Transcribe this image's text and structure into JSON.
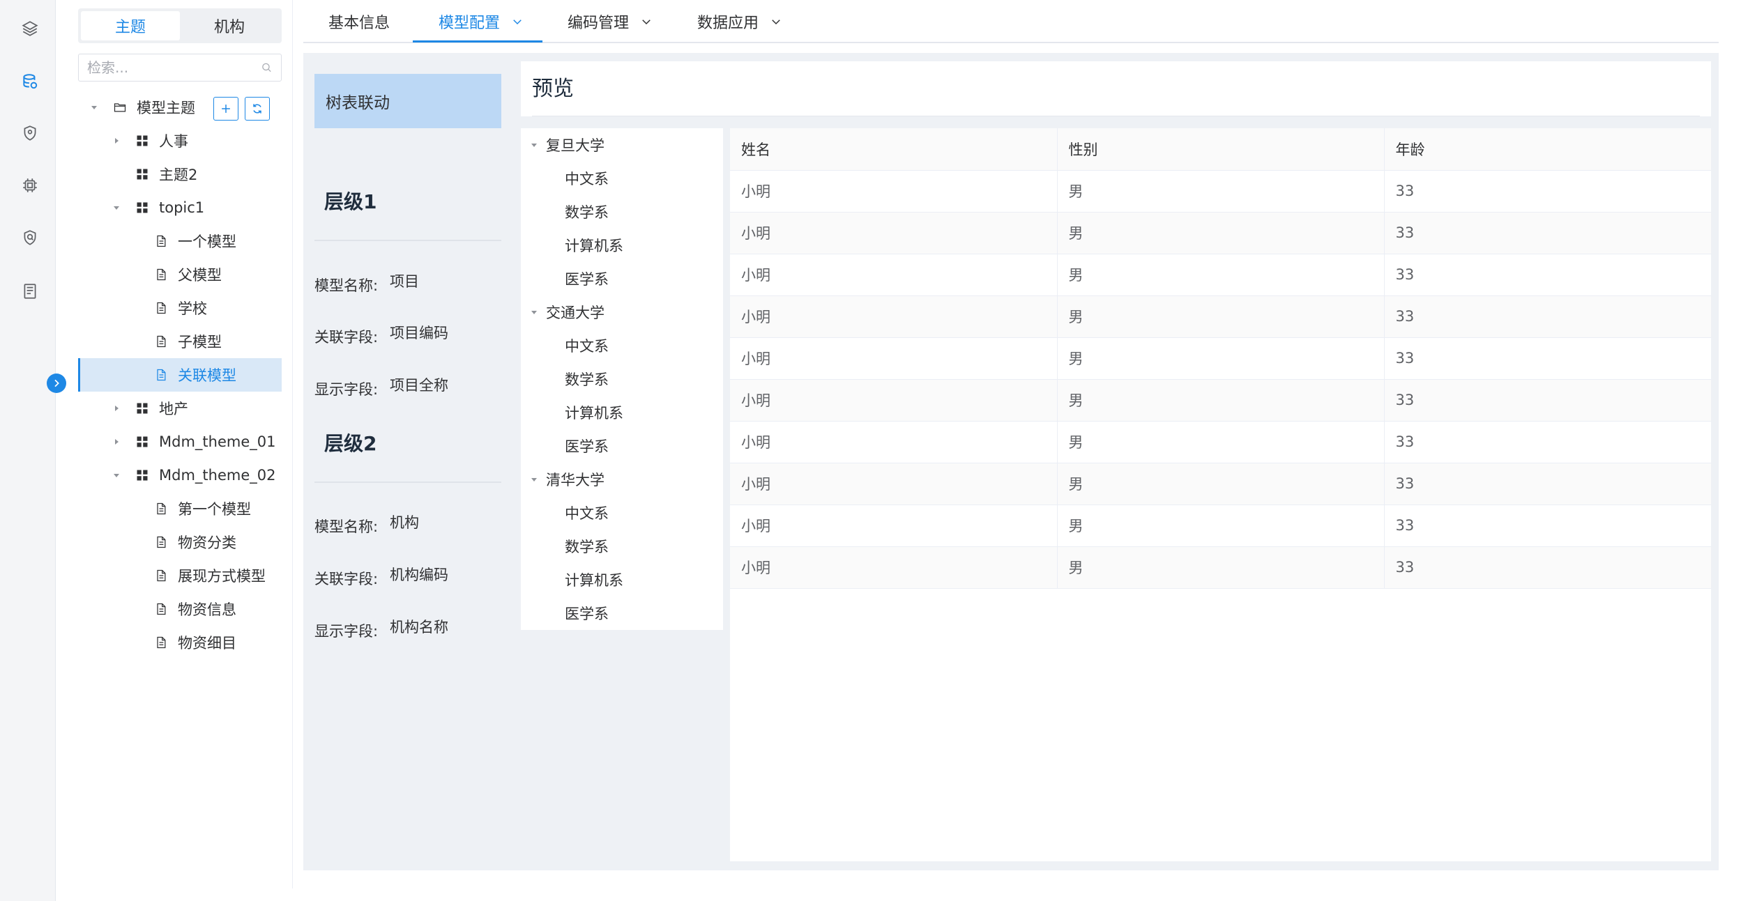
{
  "sidebar": {
    "segment": {
      "left": "主题",
      "right": "机构"
    },
    "search_placeholder": "检索...",
    "tree": [
      {
        "label": "模型主题",
        "kind": "folder",
        "caret": "down",
        "indent": 0
      },
      {
        "label": "人事",
        "kind": "grid",
        "caret": "right",
        "indent": 1
      },
      {
        "label": "主题2",
        "kind": "grid",
        "caret": "none",
        "indent": 1
      },
      {
        "label": "topic1",
        "kind": "grid",
        "caret": "down",
        "indent": 1
      },
      {
        "label": "一个模型",
        "kind": "doc",
        "caret": "none",
        "indent": 2
      },
      {
        "label": "父模型",
        "kind": "doc",
        "caret": "none",
        "indent": 2
      },
      {
        "label": "学校",
        "kind": "doc",
        "caret": "none",
        "indent": 2
      },
      {
        "label": "子模型",
        "kind": "doc",
        "caret": "none",
        "indent": 2
      },
      {
        "label": "关联模型",
        "kind": "doc",
        "caret": "none",
        "indent": 2,
        "selected": true
      },
      {
        "label": "地产",
        "kind": "grid",
        "caret": "right",
        "indent": 1
      },
      {
        "label": "Mdm_theme_01",
        "kind": "grid",
        "caret": "right",
        "indent": 1
      },
      {
        "label": "Mdm_theme_02",
        "kind": "grid",
        "caret": "down",
        "indent": 1
      },
      {
        "label": "第一个模型",
        "kind": "doc",
        "caret": "none",
        "indent": 2
      },
      {
        "label": "物资分类",
        "kind": "doc",
        "caret": "none",
        "indent": 2
      },
      {
        "label": "展现方式模型",
        "kind": "doc",
        "caret": "none",
        "indent": 2
      },
      {
        "label": "物资信息",
        "kind": "doc",
        "caret": "none",
        "indent": 2
      },
      {
        "label": "物资细目",
        "kind": "doc",
        "caret": "none",
        "indent": 2
      }
    ]
  },
  "tabs": [
    {
      "label": "基本信息",
      "chevron": false
    },
    {
      "label": "模型配置",
      "chevron": true,
      "active": true
    },
    {
      "label": "编码管理",
      "chevron": true
    },
    {
      "label": "数据应用",
      "chevron": true
    }
  ],
  "config": {
    "title": "树表联动",
    "levels": [
      {
        "title": "层级1",
        "fields": [
          {
            "label": "模型名称:",
            "value": "项目"
          },
          {
            "label": "关联字段:",
            "value": "项目编码"
          },
          {
            "label": "显示字段:",
            "value": "项目全称"
          }
        ]
      },
      {
        "title": "层级2",
        "fields": [
          {
            "label": "模型名称:",
            "value": "机构"
          },
          {
            "label": "关联字段:",
            "value": "机构编码"
          },
          {
            "label": "显示字段:",
            "value": "机构名称"
          }
        ]
      }
    ]
  },
  "preview": {
    "title": "预览",
    "org_tree": [
      {
        "label": "复旦大学",
        "children": [
          "中文系",
          "数学系",
          "计算机系",
          "医学系"
        ]
      },
      {
        "label": "交通大学",
        "children": [
          "中文系",
          "数学系",
          "计算机系",
          "医学系"
        ]
      },
      {
        "label": "清华大学",
        "children": [
          "中文系",
          "数学系",
          "计算机系",
          "医学系"
        ]
      }
    ],
    "table": {
      "columns": [
        "姓名",
        "性别",
        "年龄"
      ],
      "rows": [
        [
          "小明",
          "男",
          "33"
        ],
        [
          "小明",
          "男",
          "33"
        ],
        [
          "小明",
          "男",
          "33"
        ],
        [
          "小明",
          "男",
          "33"
        ],
        [
          "小明",
          "男",
          "33"
        ],
        [
          "小明",
          "男",
          "33"
        ],
        [
          "小明",
          "男",
          "33"
        ],
        [
          "小明",
          "男",
          "33"
        ],
        [
          "小明",
          "男",
          "33"
        ],
        [
          "小明",
          "男",
          "33"
        ]
      ]
    }
  },
  "colors": {
    "accent": "#1e88e5",
    "selected_bg": "#d9e8f7",
    "config_title_bg": "#bcd8f5",
    "panel_bg": "#eef1f5"
  }
}
